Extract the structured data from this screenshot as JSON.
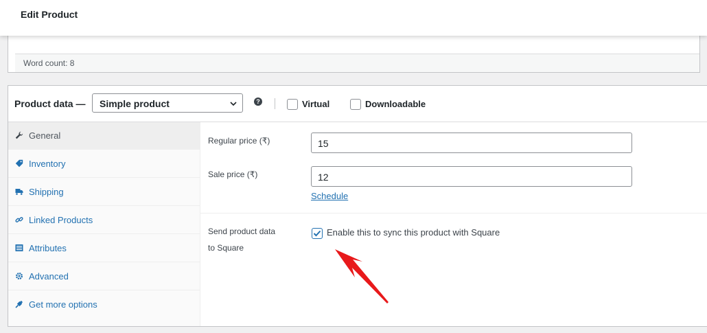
{
  "header": {
    "title": "Edit Product"
  },
  "editor": {
    "word_count": "Word count: 8"
  },
  "product_data": {
    "label": "Product data —",
    "type_select": "Simple product",
    "help_icon": "?",
    "virtual_label": "Virtual",
    "downloadable_label": "Downloadable"
  },
  "tabs": [
    {
      "label": "General",
      "icon": "wrench-icon",
      "active": true
    },
    {
      "label": "Inventory",
      "icon": "tag-icon"
    },
    {
      "label": "Shipping",
      "icon": "truck-icon"
    },
    {
      "label": "Linked Products",
      "icon": "link-icon"
    },
    {
      "label": "Attributes",
      "icon": "list-icon"
    },
    {
      "label": "Advanced",
      "icon": "gear-icon"
    },
    {
      "label": "Get more options",
      "icon": "plug-icon"
    }
  ],
  "general": {
    "regular_price_label": "Regular price (₹)",
    "regular_price_value": "15",
    "sale_price_label": "Sale price (₹)",
    "sale_price_value": "12",
    "schedule_link": "Schedule",
    "square_label_line1": "Send product data",
    "square_label_line2": "to Square",
    "square_checkbox_label": "Enable this to sync this product with Square",
    "square_checked": true
  },
  "colors": {
    "link": "#2271b1",
    "annotation_arrow": "#e8191b"
  }
}
